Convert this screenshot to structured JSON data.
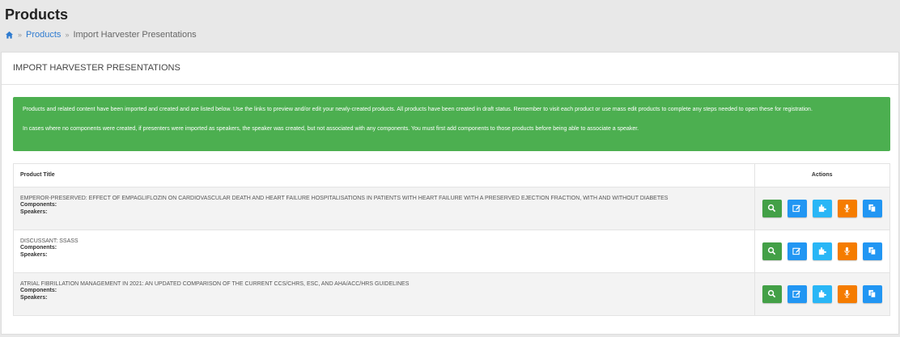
{
  "header": {
    "title": "Products",
    "breadcrumb": [
      {
        "label": "Products"
      },
      {
        "label": "Import Harvester Presentations"
      }
    ]
  },
  "panel": {
    "heading": "IMPORT HARVESTER PRESENTATIONS",
    "alert": {
      "paragraph1": "Products and related content have been imported and created and are listed below. Use the links to preview and/or edit your newly-created products. All products have been created in draft status. Remember to visit each product or use mass edit products to complete any steps needed to open these for registration.",
      "paragraph2": "In cases where no components were created, if presenters were imported as speakers, the speaker was created, but not associated with any components. You must first add components to those products before being able to associate a speaker."
    },
    "table": {
      "columns": {
        "title": "Product Title",
        "actions": "Actions"
      },
      "rows": [
        {
          "title": "EMPEROR-PRESERVED: EFFECT OF EMPAGLIFLOZIN ON CARDIOVASCULAR DEATH AND HEART FAILURE HOSPITALISATIONS IN PATIENTS WITH HEART FAILURE WITH A PRESERVED EJECTION FRACTION, WITH AND WITHOUT DIABETES",
          "components_label": "Components:",
          "speakers_label": "Speakers:"
        },
        {
          "title": "DISCUSSANT: SSaSS",
          "components_label": "Components:",
          "speakers_label": "Speakers:"
        },
        {
          "title": "ATRIAL FIBRILLATION MANAGEMENT IN 2021: AN UPDATED COMPARISON OF THE CURRENT CCS/CHRS, ESC, AND AHA/ACC/HRS GUIDELINES",
          "components_label": "Components:",
          "speakers_label": "Speakers:"
        }
      ]
    },
    "action_icons": [
      "search-icon",
      "edit-icon",
      "puzzle-icon",
      "microphone-icon",
      "copy-icon"
    ]
  },
  "colors": {
    "alert_bg": "#4caf50",
    "preview": "#43a047",
    "edit": "#2196f3",
    "components": "#29b6f6",
    "speakers": "#f57c00",
    "copy": "#2196f3",
    "link": "#2e7bd0"
  }
}
